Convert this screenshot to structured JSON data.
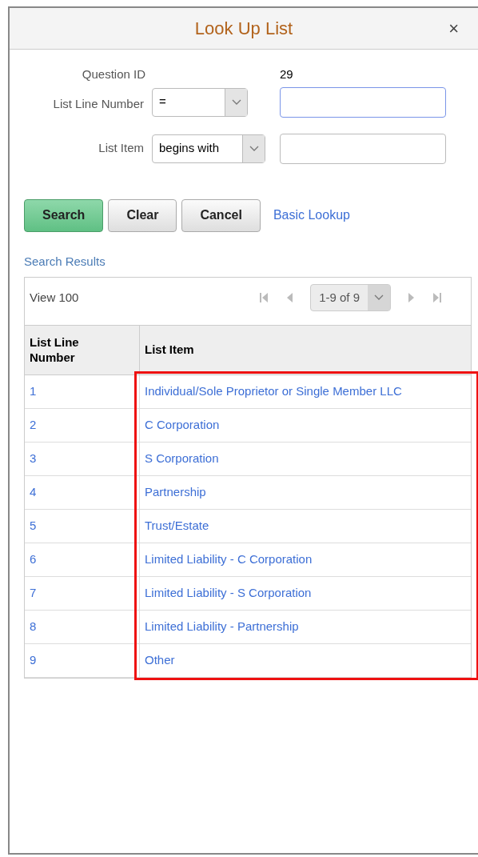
{
  "window": {
    "title": "Look Up List",
    "close": "×"
  },
  "fields": {
    "question_id": {
      "label": "Question ID",
      "value": "29"
    },
    "list_line_number": {
      "label": "List Line Number",
      "operator": "="
    },
    "list_item": {
      "label": "List Item",
      "operator": "begins with"
    }
  },
  "buttons": [
    {
      "label": "Search",
      "primary": true
    },
    {
      "label": "Clear",
      "primary": false
    },
    {
      "label": "Cancel",
      "primary": false
    }
  ],
  "basic_lookup": "Basic Lookup",
  "results": {
    "title": "Search Results",
    "view": "View 100",
    "range": "1-9 of 9",
    "columns": [
      "List Line\nNumber",
      "List Item"
    ],
    "highlighted": true,
    "rows": [
      [
        "1",
        "Individual/Sole Proprietor or Single Member LLC"
      ],
      [
        "2",
        "C Corporation"
      ],
      [
        "3",
        "S Corporation"
      ],
      [
        "4",
        "Partnership"
      ],
      [
        "5",
        "Trust/Estate"
      ],
      [
        "6",
        "Limited Liability - C Corporation"
      ],
      [
        "7",
        "Limited Liability - S Corporation"
      ],
      [
        "8",
        "Limited Liability - Partnership"
      ],
      [
        "9",
        "Other"
      ]
    ]
  }
}
